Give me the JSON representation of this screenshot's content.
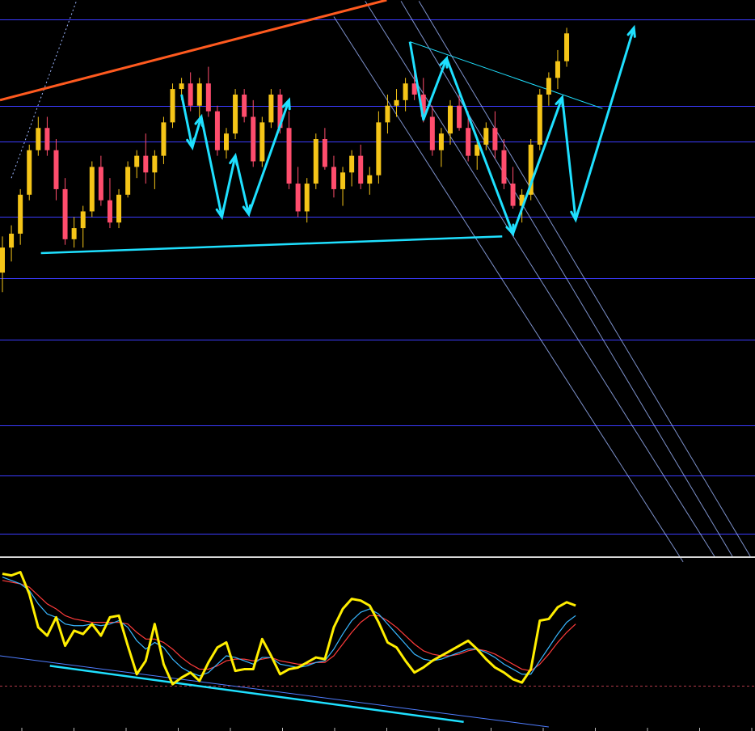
{
  "chart_data": [
    {
      "type": "candlestick",
      "panel": "price",
      "xlim": [
        0,
        140
      ],
      "ylim": [
        0,
        100
      ],
      "colors": {
        "up": "#f5c518",
        "down": "#ff4d6d",
        "grid": "#3b3bff",
        "trend_main": "#ff5a1f",
        "drawing": "#1fe0ff",
        "channel": "#9db7ff",
        "background": "#000000"
      },
      "grid_levels": [
        96.5,
        81,
        74.5,
        61,
        50,
        39,
        23.5,
        14.5,
        4
      ],
      "candles": [
        [
          0,
          51,
          57.5,
          47.5,
          55.5
        ],
        [
          3,
          55.5,
          59.5,
          53,
          58
        ],
        [
          6,
          58,
          66,
          56,
          65
        ],
        [
          9,
          65,
          74,
          64,
          73
        ],
        [
          12,
          73,
          79,
          72,
          77
        ],
        [
          15,
          77,
          79,
          72,
          73
        ],
        [
          18,
          73,
          75,
          64,
          66
        ],
        [
          21,
          66,
          68,
          56,
          57
        ],
        [
          24,
          57,
          61,
          55.5,
          59
        ],
        [
          27,
          59,
          63,
          55.5,
          62
        ],
        [
          30,
          62,
          71,
          61,
          70
        ],
        [
          33,
          70,
          72,
          63,
          64
        ],
        [
          36,
          64,
          68,
          59,
          60
        ],
        [
          39,
          60,
          66,
          59,
          65
        ],
        [
          42,
          65,
          71,
          64.5,
          70
        ],
        [
          45,
          70,
          73,
          68,
          72
        ],
        [
          48,
          72,
          76,
          67,
          69
        ],
        [
          51,
          69,
          73,
          66,
          72
        ],
        [
          54,
          72,
          79,
          70.5,
          78
        ],
        [
          57,
          78,
          85,
          77,
          84
        ],
        [
          60,
          84,
          86,
          82,
          85
        ],
        [
          63,
          85,
          87,
          80,
          81
        ],
        [
          66,
          81,
          86,
          78.5,
          85
        ],
        [
          69,
          85,
          88,
          79,
          80
        ],
        [
          72,
          80,
          81,
          72,
          73
        ],
        [
          75,
          73,
          77,
          71.5,
          76
        ],
        [
          78,
          76,
          84,
          75,
          83
        ],
        [
          81,
          83,
          84,
          78,
          79
        ],
        [
          84,
          79,
          82,
          70,
          71
        ],
        [
          87,
          71,
          79,
          70,
          78
        ],
        [
          90,
          78,
          84,
          77,
          83
        ],
        [
          93,
          83,
          84,
          76,
          77
        ],
        [
          96,
          77,
          80,
          66,
          67
        ],
        [
          99,
          67,
          70,
          61,
          62
        ],
        [
          102,
          62,
          68,
          60,
          67
        ],
        [
          105,
          67,
          76,
          66,
          75
        ],
        [
          108,
          75,
          77,
          69.5,
          70
        ],
        [
          111,
          70,
          72,
          64.5,
          66
        ],
        [
          114,
          66,
          70,
          63,
          69
        ],
        [
          117,
          69,
          73,
          66.5,
          72
        ],
        [
          120,
          72,
          74,
          66,
          67
        ],
        [
          123,
          67,
          70,
          65,
          68.5
        ],
        [
          126,
          68.5,
          80,
          67,
          78
        ],
        [
          129,
          78,
          83,
          76,
          81
        ],
        [
          132,
          81,
          84,
          79,
          82
        ],
        [
          135,
          82,
          86,
          80,
          85
        ],
        [
          138,
          85,
          87,
          82,
          83
        ],
        [
          141,
          83,
          86,
          78,
          79
        ],
        [
          144,
          79,
          81,
          72,
          73
        ],
        [
          147,
          73,
          77,
          70,
          76
        ],
        [
          150,
          76,
          82,
          74,
          81
        ],
        [
          153,
          81,
          83,
          76.5,
          77
        ],
        [
          156,
          77,
          80,
          71,
          72
        ],
        [
          159,
          72,
          75,
          69.5,
          74
        ],
        [
          162,
          74,
          78,
          73,
          77
        ],
        [
          165,
          77,
          80,
          71.5,
          73
        ],
        [
          168,
          73,
          75,
          66,
          67
        ],
        [
          171,
          67,
          70,
          62.5,
          63
        ],
        [
          174,
          63,
          66,
          60,
          65
        ],
        [
          177,
          65,
          75,
          64,
          74
        ],
        [
          180,
          74,
          84,
          73,
          83
        ],
        [
          183,
          83,
          87,
          81,
          86
        ],
        [
          186,
          86,
          91,
          84,
          89
        ],
        [
          189,
          89,
          95,
          88,
          94
        ]
      ]
    },
    {
      "type": "line",
      "panel": "oscillator",
      "ylim": [
        0,
        100
      ],
      "reference_level": 25,
      "series": [
        {
          "color": "#ffee00",
          "values": [
            92,
            91,
            93,
            80,
            60,
            55,
            66,
            49,
            58,
            56,
            62,
            55,
            66,
            67,
            49,
            32,
            40,
            62,
            38,
            26,
            30,
            33,
            28,
            39,
            48,
            51,
            34,
            35,
            35,
            53,
            43,
            32,
            35,
            36,
            39,
            42,
            41,
            60,
            71,
            77,
            76,
            73,
            63,
            51,
            48,
            40,
            33,
            36,
            40,
            43,
            46,
            49,
            52,
            47,
            41,
            36,
            33,
            29,
            27,
            35,
            64,
            65,
            72,
            75,
            73
          ]
        },
        {
          "color": "#38b6ff",
          "values": [
            90,
            88,
            86,
            82,
            74,
            68,
            66,
            62,
            61,
            61,
            62,
            61,
            62,
            64,
            60,
            52,
            47,
            51,
            48,
            41,
            36,
            33,
            31,
            33,
            38,
            43,
            42,
            40,
            38,
            42,
            42,
            38,
            37,
            36,
            37,
            39,
            40,
            47,
            56,
            64,
            69,
            71,
            68,
            62,
            56,
            50,
            44,
            41,
            40,
            41,
            43,
            45,
            47,
            47,
            45,
            42,
            38,
            35,
            32,
            32,
            40,
            48,
            56,
            63,
            67
          ]
        },
        {
          "color": "#ff3b3b",
          "values": [
            88,
            87,
            86,
            84,
            79,
            74,
            71,
            67,
            65,
            64,
            63,
            63,
            63,
            63,
            62,
            57,
            53,
            53,
            51,
            47,
            42,
            38,
            35,
            35,
            37,
            40,
            41,
            41,
            40,
            41,
            42,
            40,
            39,
            38,
            38,
            39,
            39,
            43,
            50,
            57,
            63,
            67,
            67,
            64,
            60,
            55,
            50,
            46,
            44,
            43,
            43,
            44,
            46,
            47,
            46,
            44,
            41,
            38,
            35,
            34,
            38,
            44,
            51,
            57,
            62
          ]
        }
      ]
    }
  ]
}
